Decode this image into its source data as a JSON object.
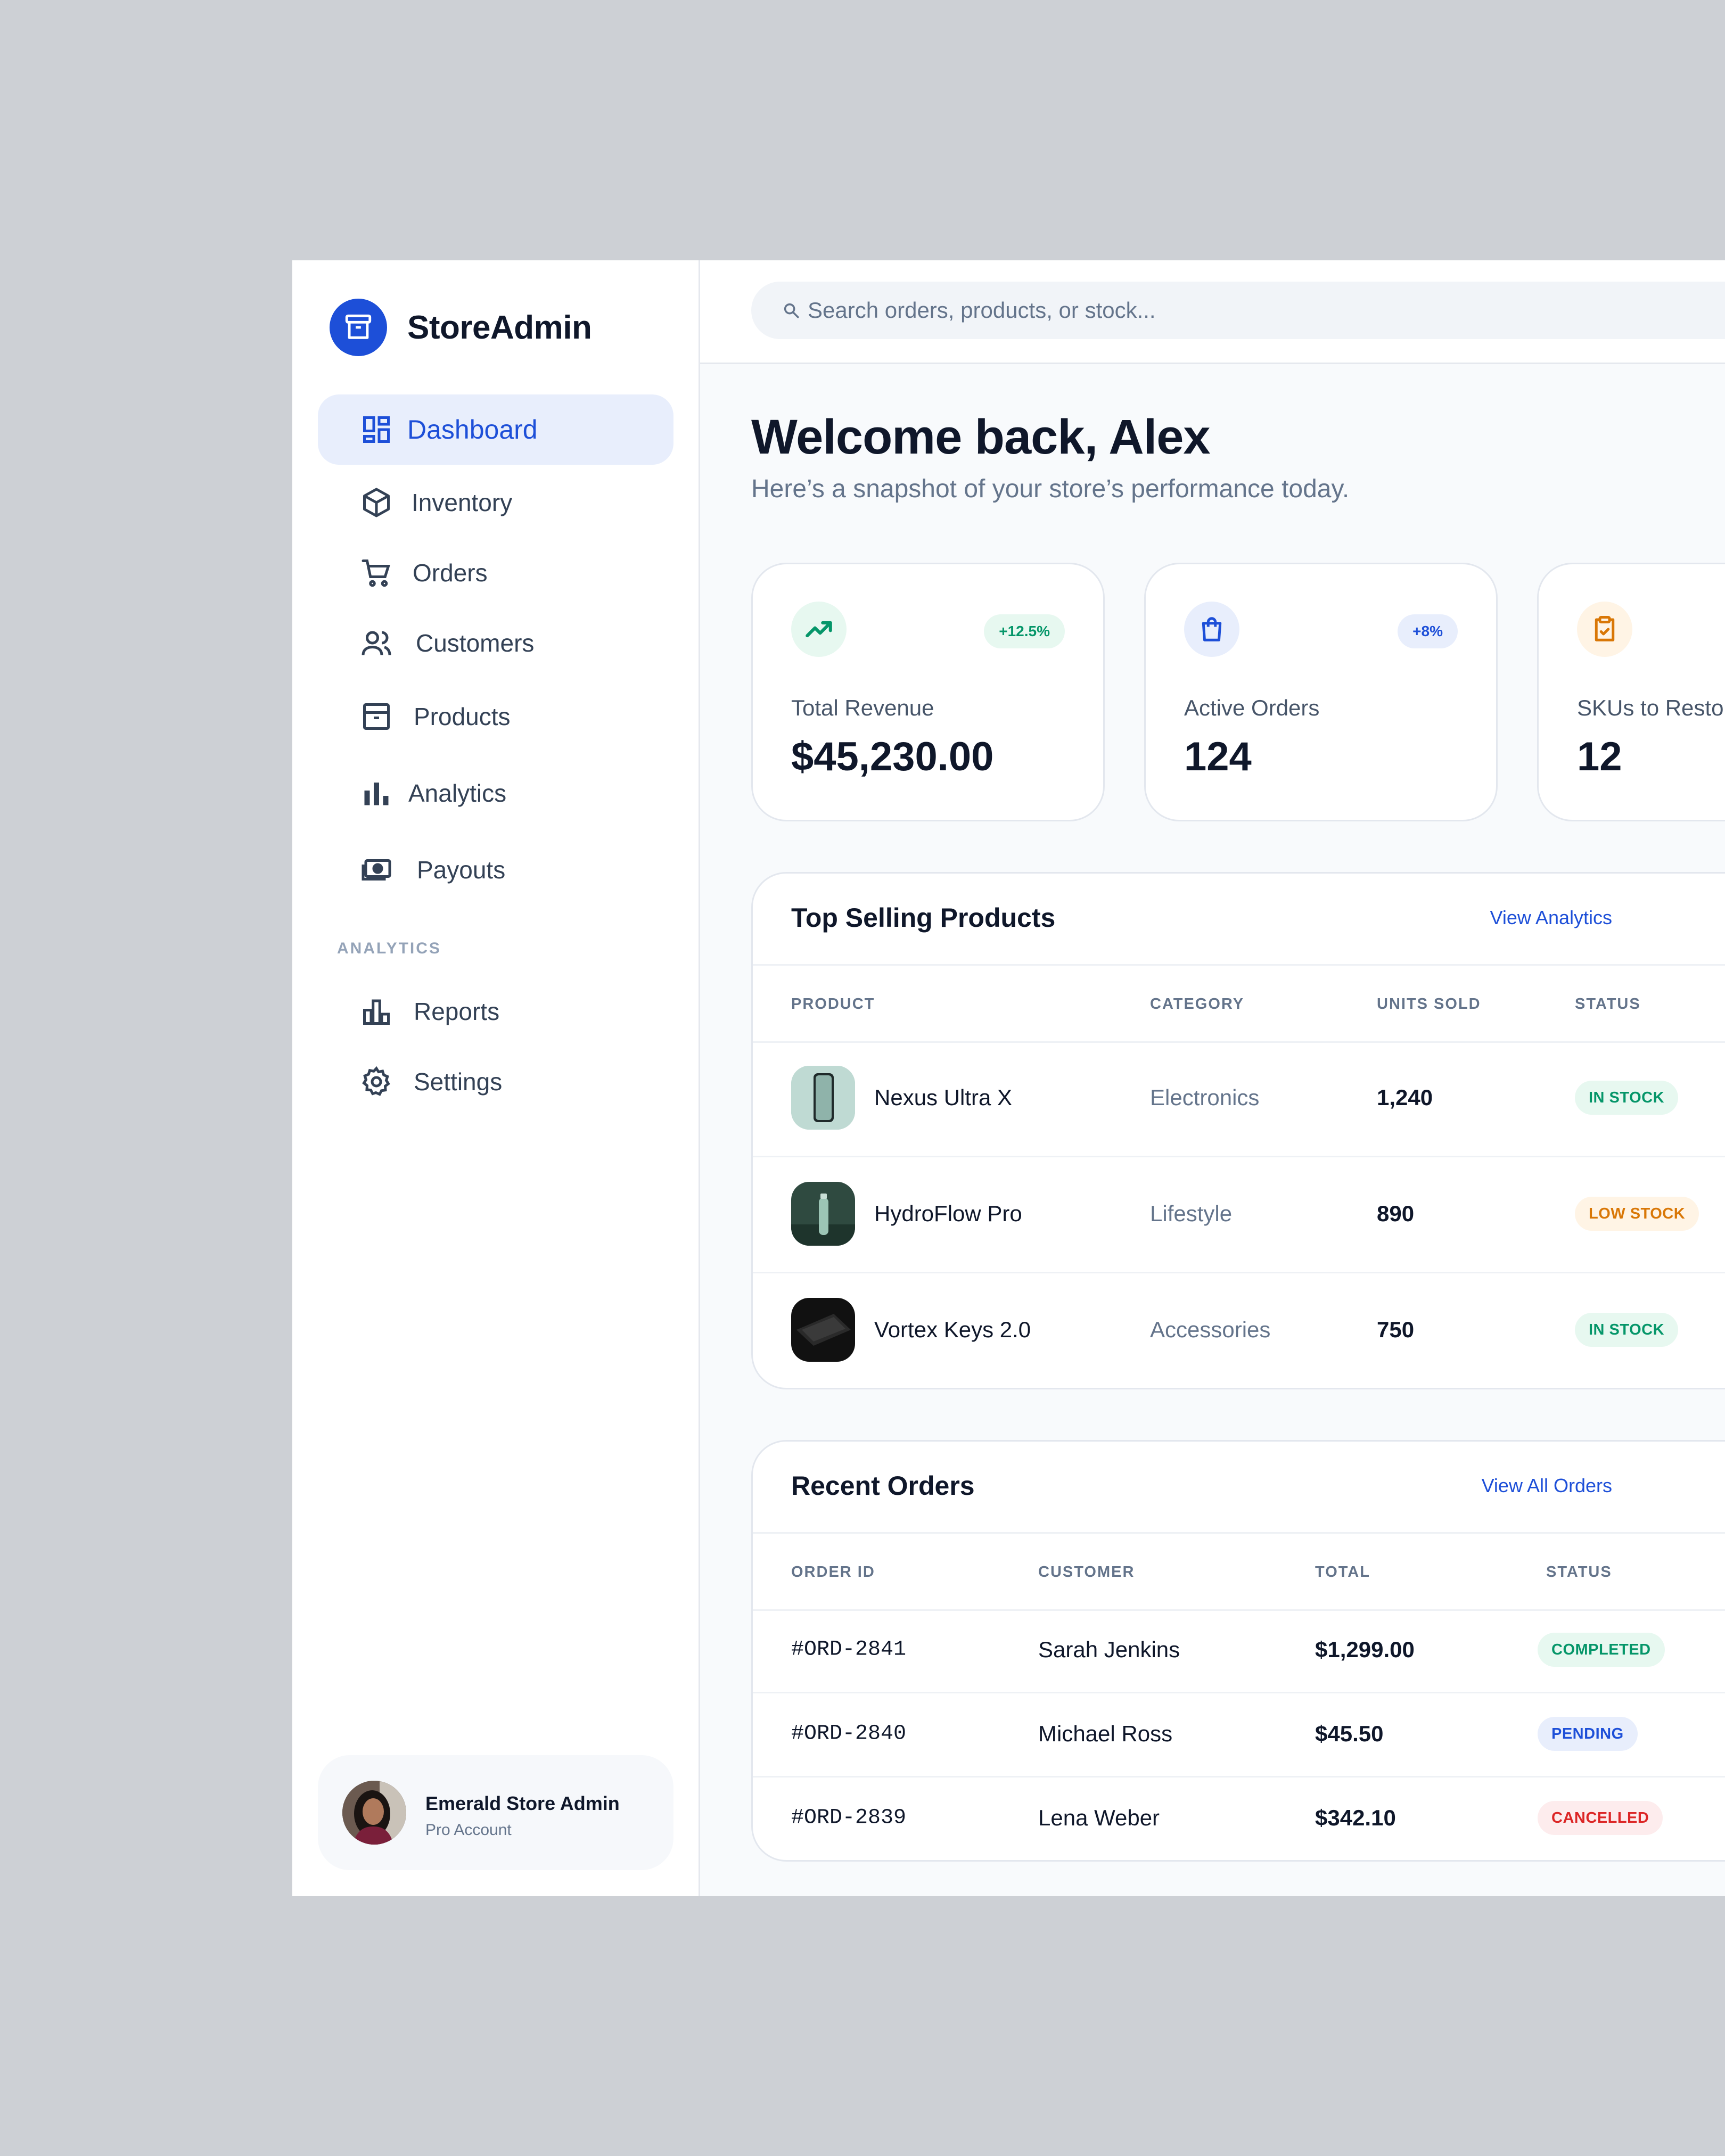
{
  "brand": {
    "name": "StoreAdmin"
  },
  "search": {
    "placeholder": "Search orders, products, or stock..."
  },
  "nav": {
    "items": [
      {
        "label": "Dashboard",
        "icon": "dashboard-icon",
        "active": true
      },
      {
        "label": "Inventory",
        "icon": "cube-icon"
      },
      {
        "label": "Orders",
        "icon": "cart-icon"
      },
      {
        "label": "Customers",
        "icon": "users-icon"
      },
      {
        "label": "Products",
        "icon": "archive-icon"
      },
      {
        "label": "Analytics",
        "icon": "bar-chart-icon"
      },
      {
        "label": "Payouts",
        "icon": "cash-icon"
      }
    ],
    "section_label": "ANALYTICS",
    "section_items": [
      {
        "label": "Reports",
        "icon": "reports-icon"
      },
      {
        "label": "Settings",
        "icon": "gear-icon"
      }
    ]
  },
  "profile": {
    "name": "Emerald Store Admin",
    "subtitle": "Pro Account"
  },
  "header": {
    "title": "Welcome back, Alex",
    "subtitle": "Here’s a snapshot of your store’s performance today."
  },
  "stats": [
    {
      "label": "Total Revenue",
      "value": "$45,230.00",
      "badge": "+12.5%",
      "icon": "trending-up-icon"
    },
    {
      "label": "Active Orders",
      "value": "124",
      "badge": "+8%",
      "icon": "shopping-bag-icon"
    },
    {
      "label": "SKUs to Resto",
      "value": "12",
      "icon": "clipboard-check-icon"
    }
  ],
  "top_products": {
    "title": "Top Selling Products",
    "link": "View Analytics",
    "columns": [
      "PRODUCT",
      "CATEGORY",
      "UNITS SOLD",
      "STATUS"
    ],
    "rows": [
      {
        "name": "Nexus Ultra X",
        "category": "Electronics",
        "units": "1,240",
        "status": "IN STOCK"
      },
      {
        "name": "HydroFlow Pro",
        "category": "Lifestyle",
        "units": "890",
        "status": "LOW STOCK"
      },
      {
        "name": "Vortex Keys 2.0",
        "category": "Accessories",
        "units": "750",
        "status": "IN STOCK"
      }
    ]
  },
  "recent_orders": {
    "title": "Recent Orders",
    "link": "View All Orders",
    "columns": [
      "ORDER ID",
      "CUSTOMER",
      "TOTAL",
      "STATUS"
    ],
    "rows": [
      {
        "id": "#ORD-2841",
        "customer": "Sarah Jenkins",
        "total": "$1,299.00",
        "status": "COMPLETED"
      },
      {
        "id": "#ORD-2840",
        "customer": "Michael Ross",
        "total": "$45.50",
        "status": "PENDING"
      },
      {
        "id": "#ORD-2839",
        "customer": "Lena Weber",
        "total": "$342.10",
        "status": "CANCELLED"
      }
    ]
  },
  "colors": {
    "accent": "#1d4fd8",
    "success": "#059669",
    "warning": "#d97706",
    "danger": "#dc2626"
  }
}
